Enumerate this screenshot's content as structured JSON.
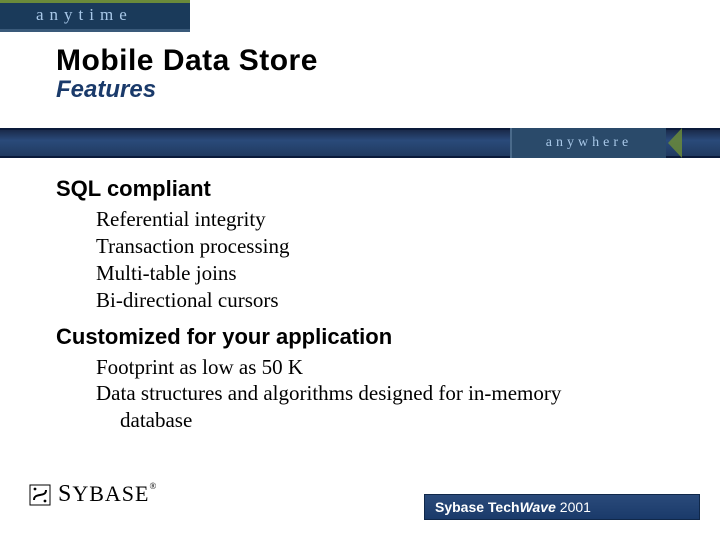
{
  "branding": {
    "anytime": "anytime",
    "anywhere": "anywhere"
  },
  "title": {
    "main": "Mobile Data Store",
    "sub": "Features"
  },
  "sections": [
    {
      "heading": "SQL compliant",
      "bullets": [
        "Referential integrity",
        "Transaction processing",
        "Multi-table joins",
        "Bi-directional cursors"
      ]
    },
    {
      "heading": "Customized for your application",
      "bullets": [
        "Footprint as low as 50 K",
        "Data structures and algorithms designed for  in-memory",
        "database"
      ]
    }
  ],
  "footer": {
    "logo_first": "S",
    "logo_rest": "YBASE",
    "reg": "®",
    "event_a": "Sybase Tech",
    "event_b": "Wave",
    "event_c": " 2001"
  }
}
